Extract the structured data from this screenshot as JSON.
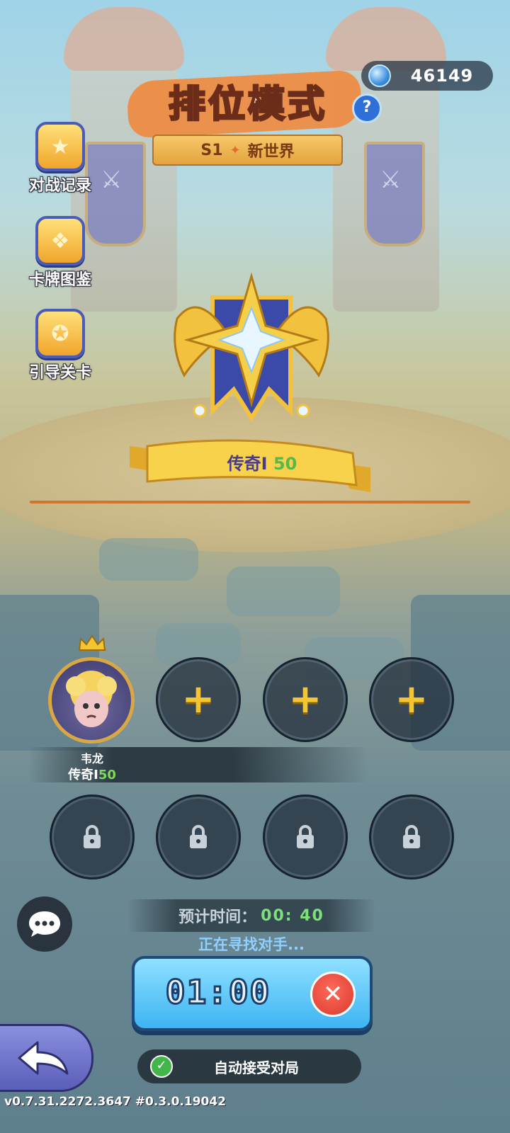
{
  "currency": {
    "icon": "gem-icon",
    "value": "46149"
  },
  "header": {
    "title": "排位模式",
    "help_icon": "question-icon",
    "season": "S1",
    "season_name": "新世界"
  },
  "side_menu": [
    {
      "label": "对战记录",
      "icon": "battle-record-icon"
    },
    {
      "label": "卡牌图鉴",
      "icon": "card-collection-icon"
    },
    {
      "label": "引导关卡",
      "icon": "tutorial-icon"
    }
  ],
  "rank": {
    "tier": "传奇",
    "level": "50",
    "emblem": "legend-emblem-icon"
  },
  "party": {
    "leader": {
      "name": "韦龙",
      "tier": "传奇",
      "level": "50"
    },
    "empty_slot_icon": "plus-icon",
    "locked_slot_icon": "lock-icon"
  },
  "matchmaking": {
    "eta_label": "预计时间：",
    "eta_value": "00: 40",
    "status": "正在寻找对手...",
    "timer": "01:00",
    "cancel_icon": "close-icon"
  },
  "bottom": {
    "back_icon": "back-arrow-icon",
    "auto_accept_label": "自动接受对局",
    "auto_accept_checked": true,
    "version": "v0.7.31.2272.3647 #0.3.0.19042"
  },
  "colors": {
    "accent_gold": "#f5c531",
    "timer_blue": "#3db4f2",
    "cancel_red": "#d93a2f",
    "check_green": "#43b649"
  }
}
